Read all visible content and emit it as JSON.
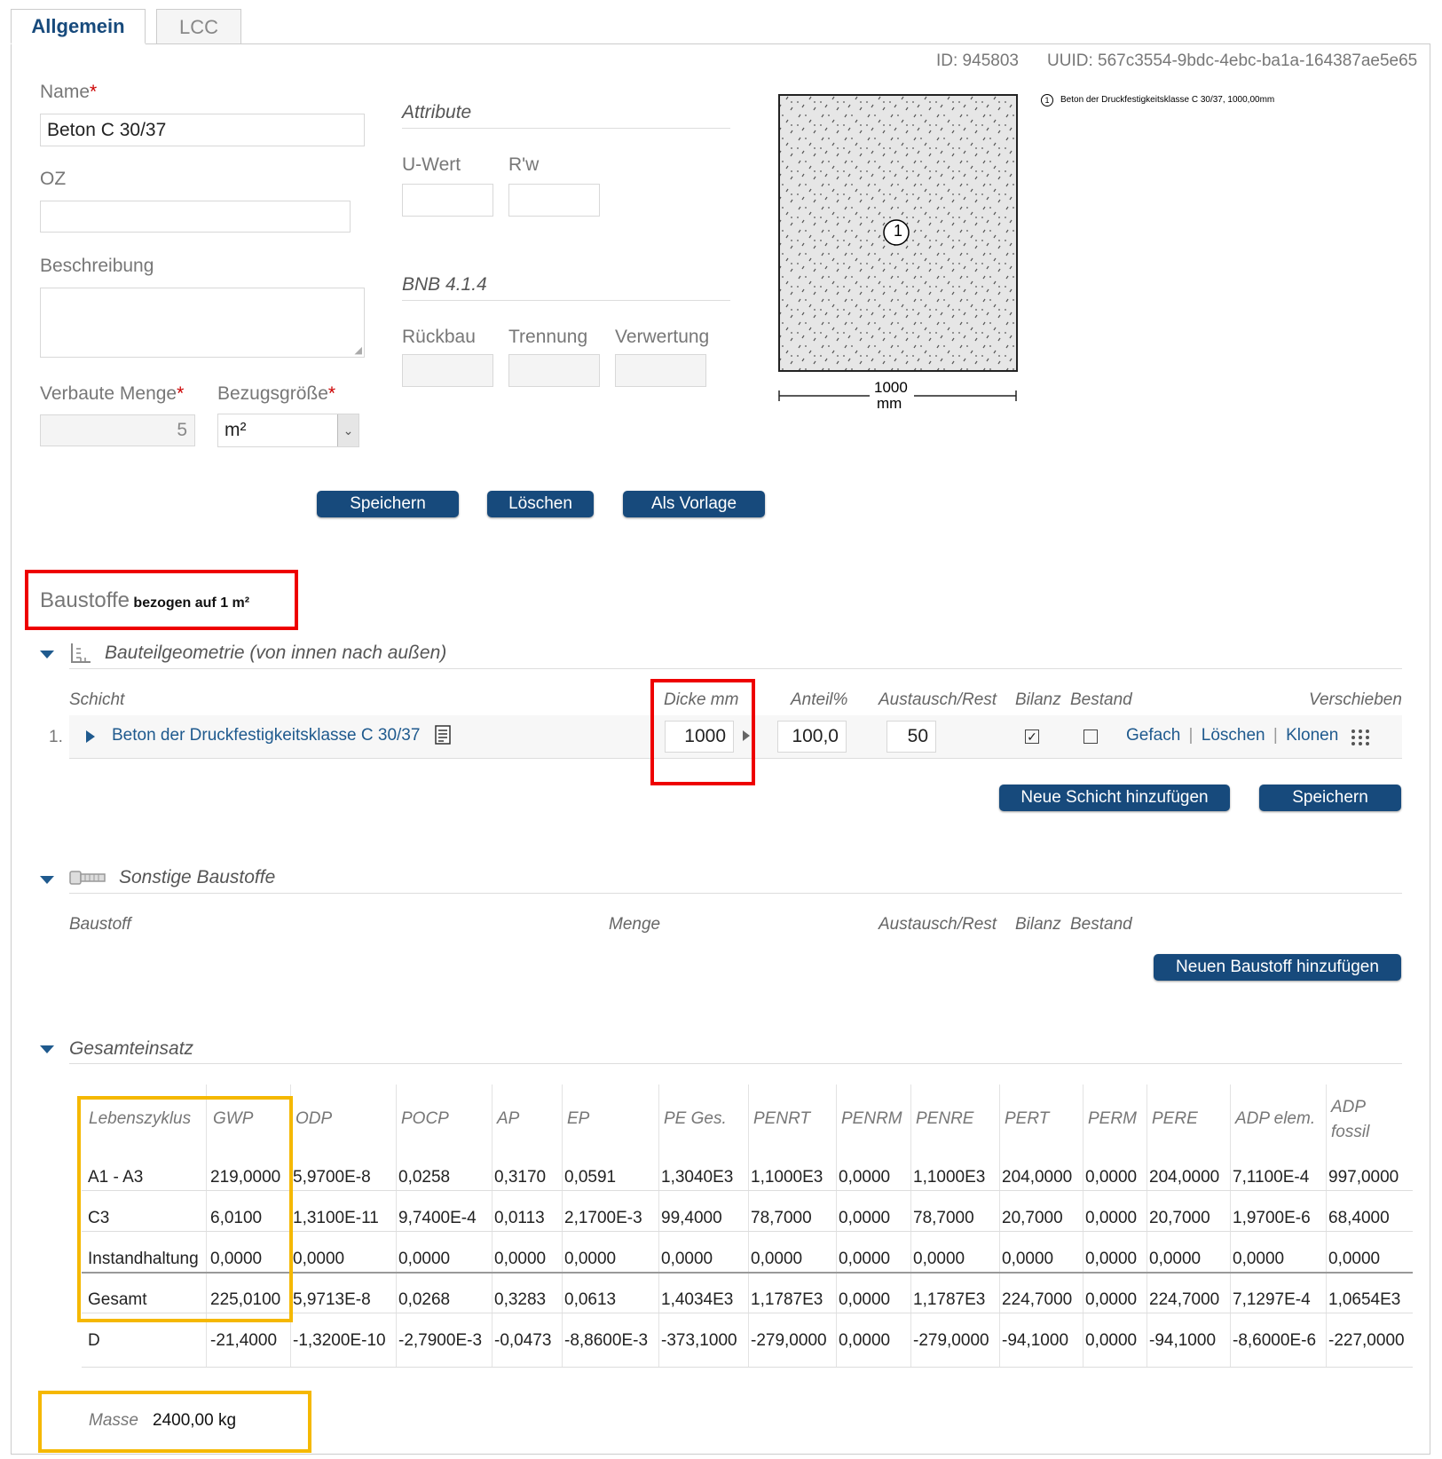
{
  "tabs": [
    "Allgemein",
    "LCC"
  ],
  "id_label": "ID: 945803",
  "uuid_label": "UUID: 567c3554-9bdc-4ebc-ba1a-164387ae5e65",
  "form": {
    "name_label": "Name",
    "name_value": "Beton C 30/37",
    "oz_label": "OZ",
    "beschreibung_label": "Beschreibung",
    "menge_label": "Verbaute Menge",
    "menge_value": "5",
    "bezug_label": "Bezugsgröße",
    "bezug_value": "m²",
    "required_mark": "*"
  },
  "attribute": {
    "title": "Attribute",
    "uwert_label": "U-Wert",
    "rw_label": "R'w"
  },
  "bnb": {
    "title": "BNB 4.1.4",
    "rueckbau_label": "Rückbau",
    "trennung_label": "Trennung",
    "verwertung_label": "Verwertung"
  },
  "diagram": {
    "layer_number": "1",
    "legend_text": "Beton der Druckfestigkeitsklasse C 30/37, 1000,00mm",
    "dim_value": "1000",
    "dim_unit": "mm"
  },
  "buttons": {
    "speichern": "Speichern",
    "loeschen": "Löschen",
    "als_vorlage": "Als Vorlage",
    "neue_schicht": "Neue Schicht hinzufügen",
    "speichern2": "Speichern",
    "neuer_baustoff": "Neuen Baustoff hinzufügen"
  },
  "baustoffe": {
    "title": "Baustoffe",
    "subtitle": "bezogen auf 1 m²"
  },
  "geometrie": {
    "title": "Bauteilgeometrie (von innen nach außen)",
    "headers": {
      "schicht": "Schicht",
      "dicke": "Dicke mm",
      "anteil": "Anteil%",
      "austausch": "Austausch/Rest",
      "bilanz": "Bilanz",
      "bestand": "Bestand",
      "verschieben": "Verschieben"
    },
    "row": {
      "index": "1.",
      "name": "Beton der Druckfestigkeitsklasse C 30/37",
      "dicke": "1000",
      "anteil": "100,0",
      "austausch": "50",
      "bilanz_checked": true,
      "bestand_checked": false,
      "actions": [
        "Gefach",
        "Löschen",
        "Klonen"
      ],
      "separator": "|"
    }
  },
  "sonstige": {
    "title": "Sonstige Baustoffe",
    "headers": {
      "baustoff": "Baustoff",
      "menge": "Menge",
      "austausch": "Austausch/Rest",
      "bilanz": "Bilanz",
      "bestand": "Bestand"
    }
  },
  "gesamteinsatz": {
    "title": "Gesamteinsatz",
    "headers": [
      "Lebenszyklus",
      "GWP",
      "ODP",
      "POCP",
      "AP",
      "EP",
      "PE Ges.",
      "PENRT",
      "PENRM",
      "PENRE",
      "PERT",
      "PERM",
      "PERE",
      "ADP elem.",
      "ADP fossil"
    ],
    "rows": [
      [
        "A1 - A3",
        "219,0000",
        "5,9700E-8",
        "0,0258",
        "0,3170",
        "0,0591",
        "1,3040E3",
        "1,1000E3",
        "0,0000",
        "1,1000E3",
        "204,0000",
        "0,0000",
        "204,0000",
        "7,1100E-4",
        "997,0000"
      ],
      [
        "C3",
        "6,0100",
        "1,3100E-11",
        "9,7400E-4",
        "0,0113",
        "2,1700E-3",
        "99,4000",
        "78,7000",
        "0,0000",
        "78,7000",
        "20,7000",
        "0,0000",
        "20,7000",
        "1,9700E-6",
        "68,4000"
      ],
      [
        "Instandhaltung",
        "0,0000",
        "0,0000",
        "0,0000",
        "0,0000",
        "0,0000",
        "0,0000",
        "0,0000",
        "0,0000",
        "0,0000",
        "0,0000",
        "0,0000",
        "0,0000",
        "0,0000",
        "0,0000"
      ],
      [
        "Gesamt",
        "225,0100",
        "5,9713E-8",
        "0,0268",
        "0,3283",
        "0,0613",
        "1,4034E3",
        "1,1787E3",
        "0,0000",
        "1,1787E3",
        "224,7000",
        "0,0000",
        "224,7000",
        "7,1297E-4",
        "1,0654E3"
      ],
      [
        "D",
        "-21,4000",
        "-1,3200E-10",
        "-2,7900E-3",
        "-0,0473",
        "-8,8600E-3",
        "-373,1000",
        "-279,0000",
        "0,0000",
        "-279,0000",
        "-94,1000",
        "0,0000",
        "-94,1000",
        "-8,6000E-6",
        "-227,0000"
      ]
    ]
  },
  "masse": {
    "label": "Masse",
    "value": "2400,00 kg"
  }
}
